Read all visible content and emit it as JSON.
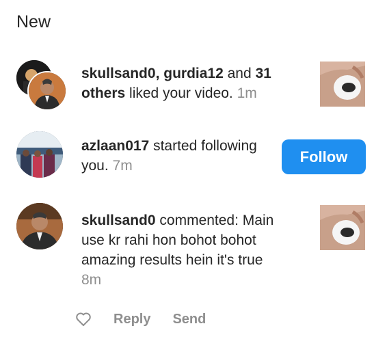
{
  "section": {
    "title": "New"
  },
  "notifications": [
    {
      "users": [
        "skullsand0",
        "gurdia12"
      ],
      "and_text": " and ",
      "others_count": "31",
      "others_word": " others",
      "action": " liked your video. ",
      "time": "1m"
    },
    {
      "user": "azlaan017",
      "action": " started following you. ",
      "time": "7m",
      "button_label": "Follow"
    },
    {
      "user": "skullsand0",
      "action": " commented:",
      "comment": "Main use kr rahi hon bohot bohot amazing results hein it's true",
      "time": "8m",
      "reply_label": "Reply",
      "send_label": "Send"
    }
  ],
  "colors": {
    "accent": "#1f8ff0",
    "muted": "#8e8e8e",
    "text": "#262626"
  }
}
